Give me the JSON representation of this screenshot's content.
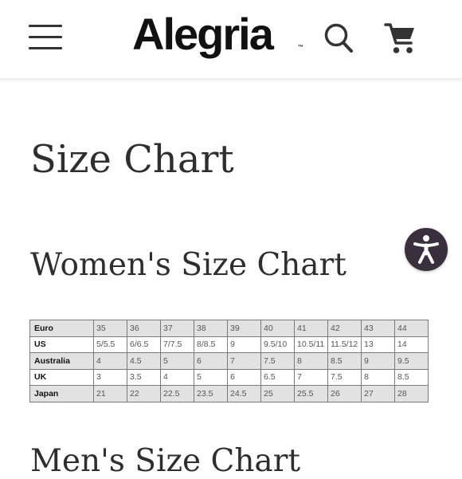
{
  "header": {
    "logo_text": "Alegria",
    "logo_tm": "™",
    "menu_icon": "hamburger-menu-icon",
    "search_icon": "search-icon",
    "cart_icon": "shopping-cart-icon"
  },
  "page": {
    "title": "Size Chart",
    "section_title": "Women's Size Chart",
    "next_section_title": "Men's Size Chart"
  },
  "accessibility": {
    "icon": "accessibility-person-icon",
    "color": "#3a2f3d"
  },
  "size_table": {
    "rows": [
      {
        "label": "Euro",
        "values": [
          "35",
          "36",
          "37",
          "38",
          "39",
          "40",
          "41",
          "42",
          "43",
          "44"
        ]
      },
      {
        "label": "US",
        "values": [
          "5/5.5",
          "6/6.5",
          "7/7.5",
          "8/8.5",
          "9",
          "9.5/10",
          "10.5/11",
          "11.5/12",
          "13",
          "14"
        ]
      },
      {
        "label": "Australia",
        "values": [
          "4",
          "4.5",
          "5",
          "6",
          "7",
          "7.5",
          "8",
          "8.5",
          "9",
          "9.5"
        ]
      },
      {
        "label": "UK",
        "values": [
          "3",
          "3.5",
          "4",
          "5",
          "6",
          "6.5",
          "7",
          "7.5",
          "8",
          "8.5"
        ]
      },
      {
        "label": "Japan",
        "values": [
          "21",
          "22",
          "22.5",
          "23.5",
          "24.5",
          "25",
          "25.5",
          "26",
          "27",
          "28"
        ]
      }
    ]
  }
}
